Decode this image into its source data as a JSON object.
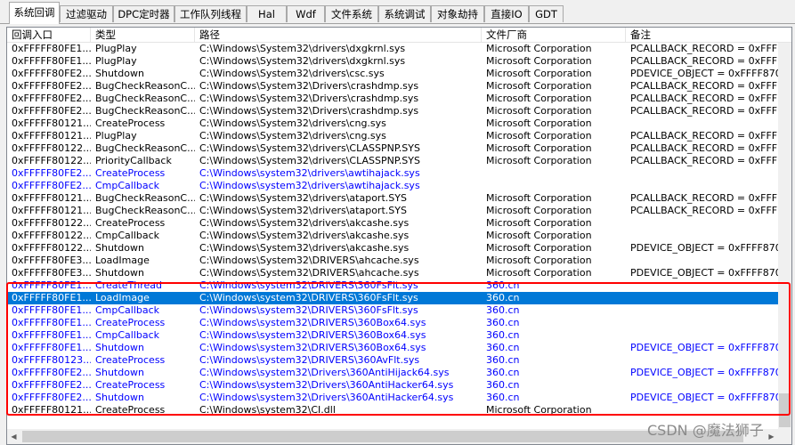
{
  "tabs": [
    {
      "label": "系统回调",
      "active": true
    },
    {
      "label": "过滤驱动",
      "active": false
    },
    {
      "label": "DPC定时器",
      "active": false
    },
    {
      "label": "工作队列线程",
      "active": false
    },
    {
      "label": "Hal",
      "active": false
    },
    {
      "label": "Wdf",
      "active": false
    },
    {
      "label": "文件系统",
      "active": false
    },
    {
      "label": "系统调试",
      "active": false
    },
    {
      "label": "对象劫持",
      "active": false
    },
    {
      "label": "直接IO",
      "active": false
    },
    {
      "label": "GDT",
      "active": false
    }
  ],
  "table": {
    "columns": [
      "回调入口",
      "类型",
      "路径",
      "文件厂商",
      "备注"
    ],
    "rows": [
      {
        "entry": "0xFFFFF80FE1...",
        "type": "PlugPlay",
        "path": "C:\\Windows\\System32\\drivers\\dxgkrnl.sys",
        "vendor": "Microsoft Corporation",
        "note": "PCALLBACK_RECORD = 0xFFFF...",
        "style": "normal"
      },
      {
        "entry": "0xFFFFF80FE1...",
        "type": "PlugPlay",
        "path": "C:\\Windows\\System32\\drivers\\dxgkrnl.sys",
        "vendor": "Microsoft Corporation",
        "note": "PCALLBACK_RECORD = 0xFFFF...",
        "style": "normal"
      },
      {
        "entry": "0xFFFFF80FE2...",
        "type": "Shutdown",
        "path": "C:\\Windows\\System32\\drivers\\csc.sys",
        "vendor": "Microsoft Corporation",
        "note": "PDEVICE_OBJECT = 0xFFFF8704...",
        "style": "normal"
      },
      {
        "entry": "0xFFFFF80FE2...",
        "type": "BugCheckReasonC...",
        "path": "C:\\Windows\\System32\\Drivers\\crashdmp.sys",
        "vendor": "Microsoft Corporation",
        "note": "PCALLBACK_RECORD = 0xFFFF8...",
        "style": "normal"
      },
      {
        "entry": "0xFFFFF80FE2...",
        "type": "BugCheckReasonC...",
        "path": "C:\\Windows\\System32\\Drivers\\crashdmp.sys",
        "vendor": "Microsoft Corporation",
        "note": "PCALLBACK_RECORD = 0xFFFF8...",
        "style": "normal"
      },
      {
        "entry": "0xFFFFF80FE2...",
        "type": "BugCheckReasonC...",
        "path": "C:\\Windows\\System32\\Drivers\\crashdmp.sys",
        "vendor": "Microsoft Corporation",
        "note": "PCALLBACK_RECORD = 0xFFFF8...",
        "style": "normal"
      },
      {
        "entry": "0xFFFFF80121...",
        "type": "CreateProcess",
        "path": "C:\\Windows\\System32\\drivers\\cng.sys",
        "vendor": "Microsoft Corporation",
        "note": "",
        "style": "normal"
      },
      {
        "entry": "0xFFFFF80121...",
        "type": "PlugPlay",
        "path": "C:\\Windows\\System32\\drivers\\cng.sys",
        "vendor": "Microsoft Corporation",
        "note": "PCALLBACK_RECORD = 0xFFFF...",
        "style": "normal"
      },
      {
        "entry": "0xFFFFF80122...",
        "type": "BugCheckReasonC...",
        "path": "C:\\Windows\\System32\\drivers\\CLASSPNP.SYS",
        "vendor": "Microsoft Corporation",
        "note": "PCALLBACK_RECORD = 0xFFFF8...",
        "style": "normal"
      },
      {
        "entry": "0xFFFFF80122...",
        "type": "PriorityCallback",
        "path": "C:\\Windows\\System32\\drivers\\CLASSPNP.SYS",
        "vendor": "Microsoft Corporation",
        "note": "PCALLBACK_RECORD = 0xFFFF8...",
        "style": "normal"
      },
      {
        "entry": "0xFFFFF80FE2...",
        "type": "CreateProcess",
        "path": "C:\\Windows\\system32\\drivers\\awtihajack.sys",
        "vendor": "",
        "note": "",
        "style": "blue"
      },
      {
        "entry": "0xFFFFF80FE2...",
        "type": "CmpCallback",
        "path": "C:\\Windows\\system32\\drivers\\awtihajack.sys",
        "vendor": "",
        "note": "",
        "style": "blue"
      },
      {
        "entry": "0xFFFFF80121...",
        "type": "BugCheckReasonC...",
        "path": "C:\\Windows\\System32\\drivers\\ataport.SYS",
        "vendor": "Microsoft Corporation",
        "note": "PCALLBACK_RECORD = 0xFFFF...",
        "style": "normal"
      },
      {
        "entry": "0xFFFFF80121...",
        "type": "BugCheckReasonC...",
        "path": "C:\\Windows\\System32\\drivers\\ataport.SYS",
        "vendor": "Microsoft Corporation",
        "note": "PCALLBACK_RECORD = 0xFFFF...",
        "style": "normal"
      },
      {
        "entry": "0xFFFFF80122...",
        "type": "CreateProcess",
        "path": "C:\\Windows\\System32\\drivers\\akcashe.sys",
        "vendor": "Microsoft Corporation",
        "note": "",
        "style": "normal"
      },
      {
        "entry": "0xFFFFF80122...",
        "type": "CmpCallback",
        "path": "C:\\Windows\\System32\\drivers\\akcashe.sys",
        "vendor": "Microsoft Corporation",
        "note": "",
        "style": "normal"
      },
      {
        "entry": "0xFFFFF80122...",
        "type": "Shutdown",
        "path": "C:\\Windows\\System32\\drivers\\akcashe.sys",
        "vendor": "Microsoft Corporation",
        "note": "PDEVICE_OBJECT = 0xFFFF8704...",
        "style": "normal"
      },
      {
        "entry": "0xFFFFF80FE3...",
        "type": "LoadImage",
        "path": "C:\\Windows\\System32\\DRIVERS\\ahcache.sys",
        "vendor": "Microsoft Corporation",
        "note": "",
        "style": "normal"
      },
      {
        "entry": "0xFFFFF80FE3...",
        "type": "Shutdown",
        "path": "C:\\Windows\\System32\\DRIVERS\\ahcache.sys",
        "vendor": "Microsoft Corporation",
        "note": "PDEVICE_OBJECT = 0xFFFF8704...",
        "style": "normal"
      },
      {
        "entry": "0xFFFFF80FE1...",
        "type": "CreateThread",
        "path": "C:\\Windows\\system32\\DRIVERS\\360FsFlt.sys",
        "vendor": "360.cn",
        "note": "",
        "style": "blue"
      },
      {
        "entry": "0xFFFFF80FE1...",
        "type": "LoadImage",
        "path": "C:\\Windows\\system32\\DRIVERS\\360FsFlt.sys",
        "vendor": "360.cn",
        "note": "",
        "style": "selected"
      },
      {
        "entry": "0xFFFFF80FE1...",
        "type": "CmpCallback",
        "path": "C:\\Windows\\system32\\DRIVERS\\360FsFlt.sys",
        "vendor": "360.cn",
        "note": "",
        "style": "blue"
      },
      {
        "entry": "0xFFFFF80FE1...",
        "type": "CreateProcess",
        "path": "C:\\Windows\\system32\\DRIVERS\\360Box64.sys",
        "vendor": "360.cn",
        "note": "",
        "style": "blue"
      },
      {
        "entry": "0xFFFFF80FE1...",
        "type": "CmpCallback",
        "path": "C:\\Windows\\system32\\DRIVERS\\360Box64.sys",
        "vendor": "360.cn",
        "note": "",
        "style": "blue"
      },
      {
        "entry": "0xFFFFF80FE1...",
        "type": "Shutdown",
        "path": "C:\\Windows\\system32\\DRIVERS\\360Box64.sys",
        "vendor": "360.cn",
        "note": "PDEVICE_OBJECT = 0xFFFF8704...",
        "style": "blue"
      },
      {
        "entry": "0xFFFFF80123...",
        "type": "CreateProcess",
        "path": "C:\\Windows\\system32\\DRIVERS\\360AvFlt.sys",
        "vendor": "360.cn",
        "note": "",
        "style": "blue"
      },
      {
        "entry": "0xFFFFF80FE2...",
        "type": "Shutdown",
        "path": "C:\\Windows\\system32\\Drivers\\360AntiHijack64.sys",
        "vendor": "360.cn",
        "note": "PDEVICE_OBJECT = 0xFFFF8704...",
        "style": "blue"
      },
      {
        "entry": "0xFFFFF80FE2...",
        "type": "CreateProcess",
        "path": "C:\\Windows\\system32\\Drivers\\360AntiHacker64.sys",
        "vendor": "360.cn",
        "note": "",
        "style": "blue"
      },
      {
        "entry": "0xFFFFF80FE2...",
        "type": "Shutdown",
        "path": "C:\\Windows\\system32\\Drivers\\360AntiHacker64.sys",
        "vendor": "360.cn",
        "note": "PDEVICE_OBJECT = 0xFFFF8704...",
        "style": "blue"
      },
      {
        "entry": "0xFFFFF80121...",
        "type": "CreateProcess",
        "path": "C:\\Windows\\system32\\CI.dll",
        "vendor": "Microsoft Corporation",
        "note": "",
        "style": "normal"
      }
    ]
  },
  "colors": {
    "selected_bg": "#0078d7",
    "unsigned_text": "#0000ff",
    "highlight_box": "#ff0000"
  },
  "scrollbar_icons": {
    "left": "triangle-left-icon",
    "right": "triangle-right-icon"
  },
  "watermark": "CSDN @魔法狮子"
}
